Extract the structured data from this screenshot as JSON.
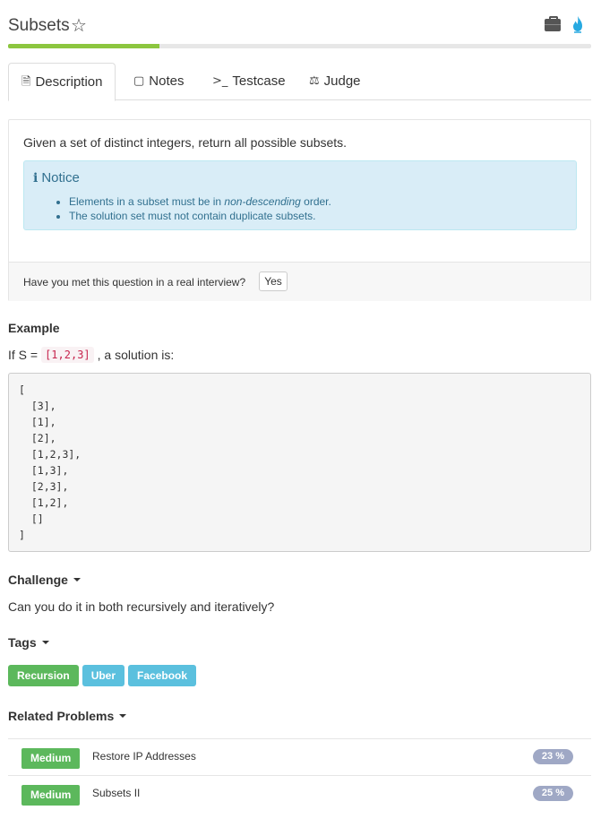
{
  "header": {
    "title": "Subsets",
    "star_icon": "star-outline-icon",
    "briefcase_icon": "briefcase-icon",
    "flame_icon": "flame-icon"
  },
  "progress": {
    "fraction": 0.26,
    "color": "#8cc63f"
  },
  "tabs": [
    {
      "label": "Description",
      "icon": "document-icon",
      "active": true
    },
    {
      "label": "Notes",
      "icon": "note-icon",
      "active": false
    },
    {
      "label": "Testcase",
      "icon": "terminal-icon",
      "active": false
    },
    {
      "label": "Judge",
      "icon": "scale-icon",
      "active": false
    }
  ],
  "description": {
    "question": "Given a set of distinct integers, return all possible subsets.",
    "notice": {
      "title": "Notice",
      "items": [
        {
          "before": "Elements in a subset must be in ",
          "emph": "non-descending",
          "after": " order."
        },
        {
          "before": "The solution set must not contain duplicate subsets.",
          "emph": "",
          "after": ""
        }
      ]
    },
    "interview_question": "Have you met this question in a real interview?",
    "yes_label": "Yes"
  },
  "example": {
    "heading": "Example",
    "prefix": "If S =",
    "set": "[1,2,3]",
    "suffix": ", a solution is:",
    "code": "[\n  [3],\n  [1],\n  [2],\n  [1,2,3],\n  [1,3],\n  [2,3],\n  [1,2],\n  []\n]"
  },
  "challenge": {
    "heading": "Challenge",
    "text": "Can you do it in both recursively and iteratively?"
  },
  "tags": {
    "heading": "Tags",
    "items": [
      {
        "label": "Recursion",
        "color": "#5cb85c"
      },
      {
        "label": "Uber",
        "color": "#5bc0de"
      },
      {
        "label": "Facebook",
        "color": "#5bc0de"
      }
    ]
  },
  "related": {
    "heading": "Related Problems",
    "items": [
      {
        "level": "Medium",
        "name": "Restore IP Addresses",
        "rate": "23 %"
      },
      {
        "level": "Medium",
        "name": "Subsets II",
        "rate": "25 %"
      }
    ]
  }
}
